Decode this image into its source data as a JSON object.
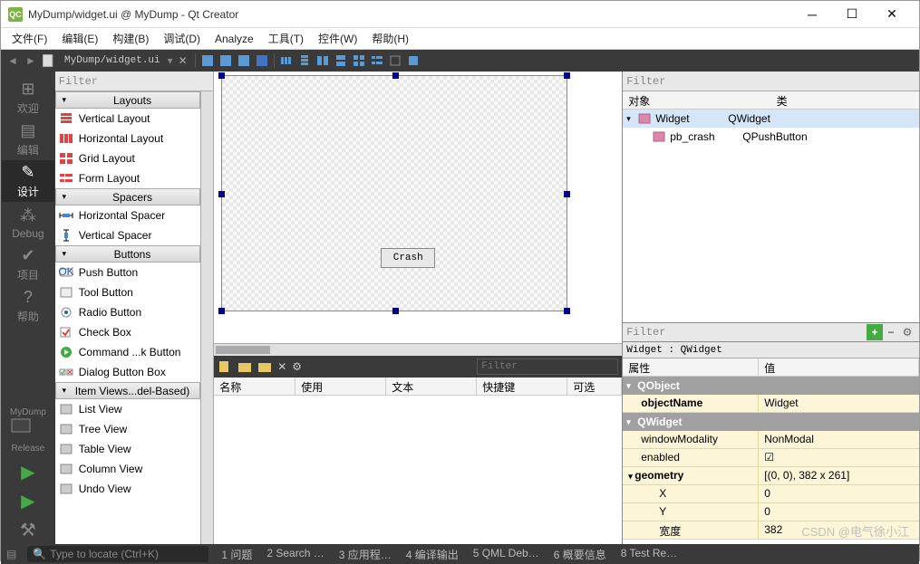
{
  "window": {
    "title": "MyDump/widget.ui @ MyDump - Qt Creator"
  },
  "menu": [
    "文件(F)",
    "编辑(E)",
    "构建(B)",
    "调试(D)",
    "Analyze",
    "工具(T)",
    "控件(W)",
    "帮助(H)"
  ],
  "toolbar": {
    "path": "MyDump/widget.ui"
  },
  "sidebar": {
    "modes": [
      {
        "label": "欢迎",
        "icon": "grid"
      },
      {
        "label": "编辑",
        "icon": "doc"
      },
      {
        "label": "设计",
        "icon": "pencil",
        "active": true
      },
      {
        "label": "Debug",
        "icon": "bug"
      },
      {
        "label": "项目",
        "icon": "wrench"
      },
      {
        "label": "帮助",
        "icon": "help"
      }
    ],
    "project": "MyDump",
    "build": "Release"
  },
  "widgetbox": {
    "filter_placeholder": "Filter",
    "groups": [
      {
        "name": "Layouts",
        "items": [
          "Vertical Layout",
          "Horizontal Layout",
          "Grid Layout",
          "Form Layout"
        ]
      },
      {
        "name": "Spacers",
        "items": [
          "Horizontal Spacer",
          "Vertical Spacer"
        ]
      },
      {
        "name": "Buttons",
        "items": [
          "Push Button",
          "Tool Button",
          "Radio Button",
          "Check Box",
          "Command ...k Button",
          "Dialog Button Box"
        ]
      },
      {
        "name": "Item Views...del-Based)",
        "items": [
          "List View",
          "Tree View",
          "Table View",
          "Column View",
          "Undo View"
        ]
      }
    ]
  },
  "canvas": {
    "button_label": "Crash"
  },
  "action_editor": {
    "filter_placeholder": "Filter",
    "columns": [
      "名称",
      "使用",
      "文本",
      "快捷键",
      "可选"
    ]
  },
  "object_inspector": {
    "filter_placeholder": "Filter",
    "columns": [
      "对象",
      "类"
    ],
    "rows": [
      {
        "name": "Widget",
        "class": "QWidget",
        "sel": true,
        "indent": 0,
        "expandable": true
      },
      {
        "name": "pb_crash",
        "class": "QPushButton",
        "sel": false,
        "indent": 1,
        "expandable": false
      }
    ]
  },
  "property_editor": {
    "filter_placeholder": "Filter",
    "title": "Widget : QWidget",
    "columns": [
      "属性",
      "值"
    ],
    "groups": [
      {
        "name": "QObject",
        "props": [
          {
            "name": "objectName",
            "value": "Widget",
            "bold": true
          }
        ]
      },
      {
        "name": "QWidget",
        "props": [
          {
            "name": "windowModality",
            "value": "NonModal"
          },
          {
            "name": "enabled",
            "value": "☑"
          },
          {
            "name": "geometry",
            "value": "[(0, 0), 382 x 261]",
            "bold": true,
            "expandable": true
          },
          {
            "name": "X",
            "value": "0",
            "indent": true
          },
          {
            "name": "Y",
            "value": "0",
            "indent": true
          },
          {
            "name": "宽度",
            "value": "382",
            "indent": true
          }
        ]
      }
    ]
  },
  "statusbar": {
    "locate_placeholder": "Type to locate (Ctrl+K)",
    "items": [
      "1  问题",
      "2  Search …",
      "3  应用程…",
      "4  编译输出",
      "5  QML Deb…",
      "6  概要信息",
      "8  Test Re…"
    ]
  },
  "watermark": "CSDN @电气徐小江"
}
